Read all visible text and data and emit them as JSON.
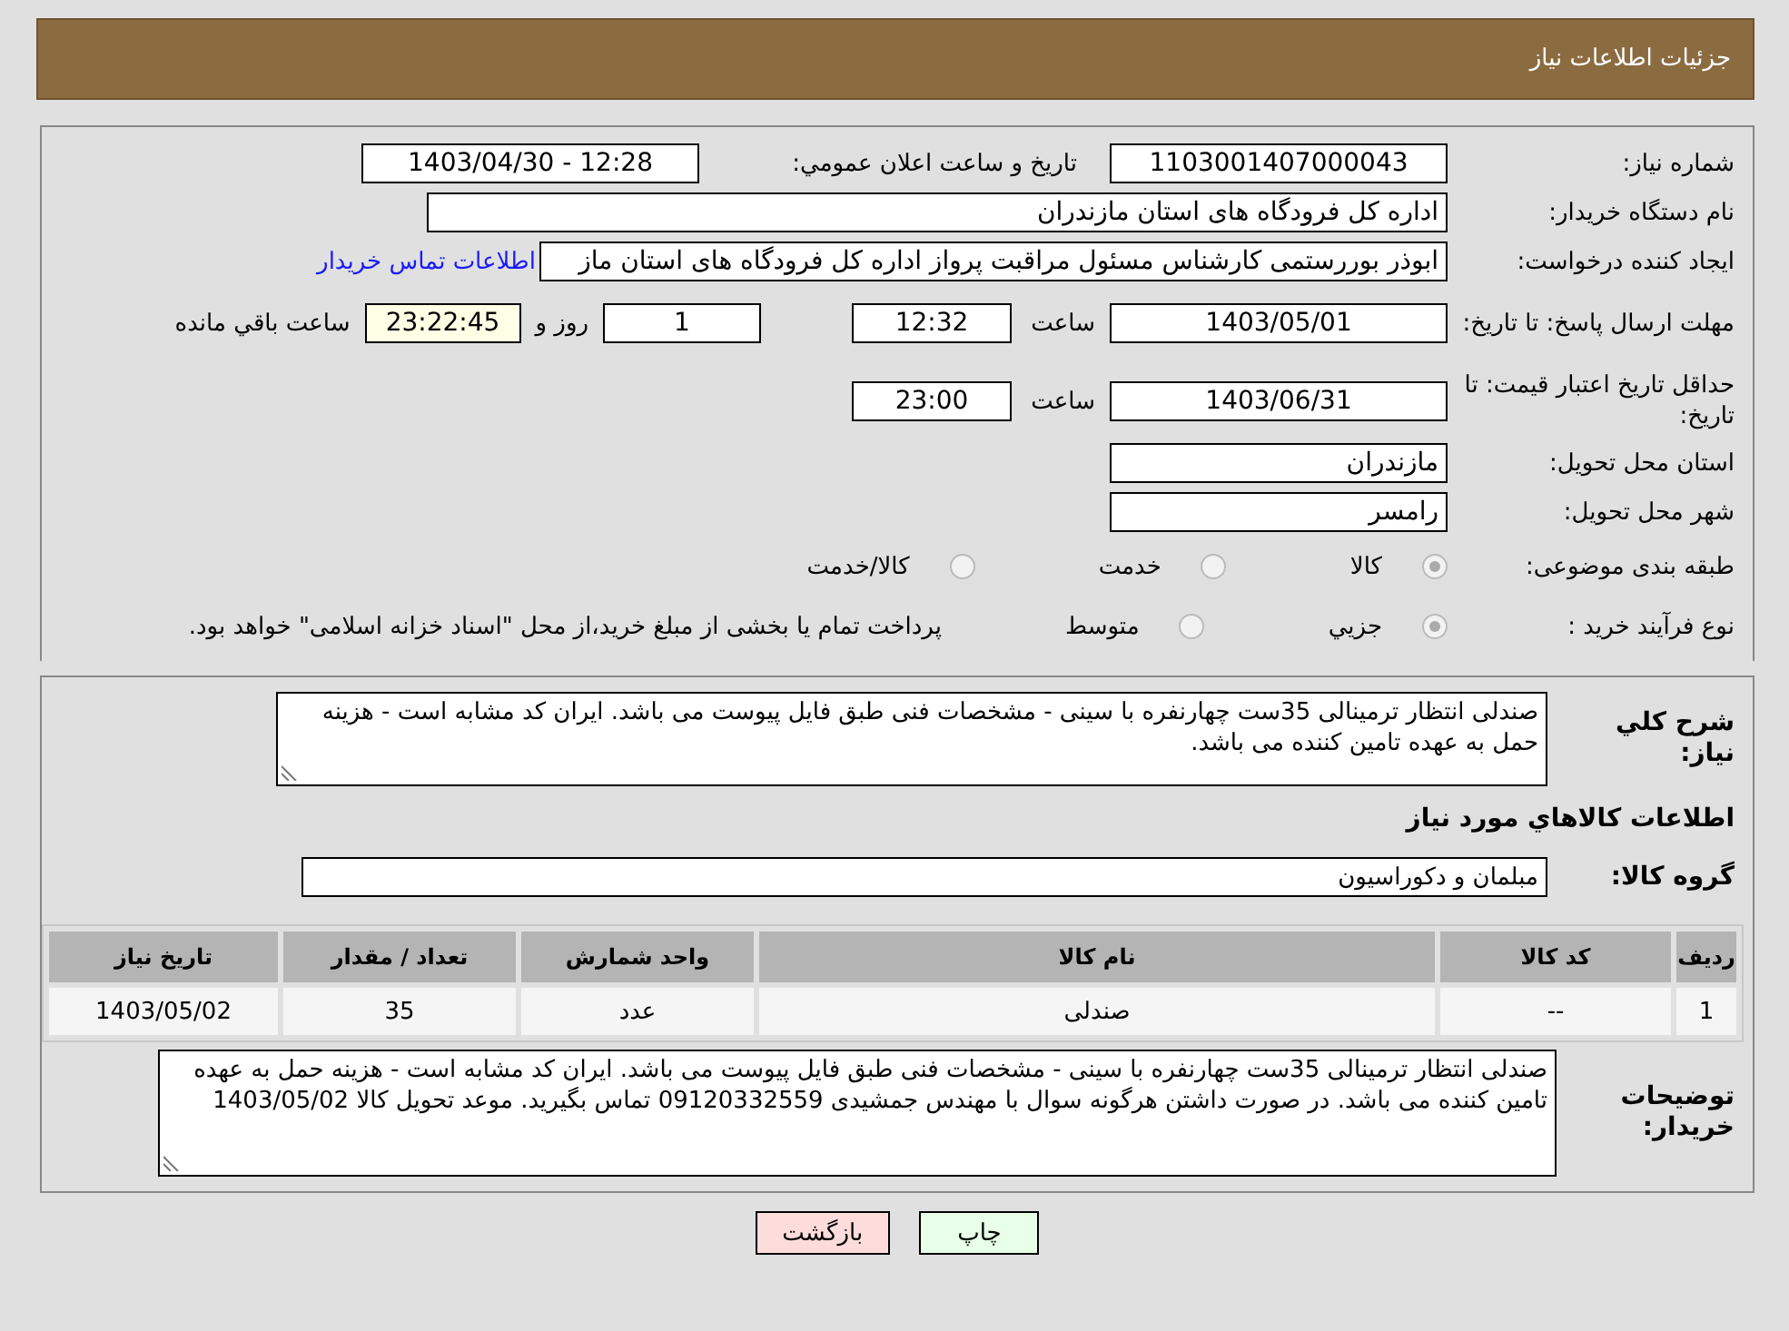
{
  "header": {
    "title": "جزئیات اطلاعات نیاز"
  },
  "need_number": {
    "label": "شماره نیاز:",
    "value": "1103001407000043"
  },
  "announce": {
    "label": "تاريخ و ساعت اعلان عمومي:",
    "value": "1403/04/30 - 12:28"
  },
  "buyer": {
    "label": "نام دستگاه خريدار:",
    "value": "اداره کل فرودگاه های استان مازندران"
  },
  "requester": {
    "label": "ايجاد کننده درخواست:",
    "value": "ابوذر بوررستمی کارشناس مسئول مراقبت پرواز اداره کل فرودگاه های استان ماز",
    "link": "اطلاعات تماس خريدار"
  },
  "deadline": {
    "label": "مهلت ارسال پاسخ: تا تاریخ:",
    "date": "1403/05/01",
    "time_label": "ساعت",
    "time": "12:32",
    "days": "1",
    "days_label": "روز و",
    "remaining": "23:22:45",
    "remaining_label": "ساعت باقي مانده"
  },
  "validity": {
    "label": "حداقل تاريخ اعتبار قيمت: تا تاریخ:",
    "date": "1403/06/31",
    "time_label": "ساعت",
    "time": "23:00"
  },
  "province": {
    "label": "استان محل تحويل:",
    "value": "مازندران"
  },
  "city": {
    "label": "شهر محل تحويل:",
    "value": "رامسر"
  },
  "category": {
    "label": "طبقه بندی موضوعی:",
    "options": [
      {
        "label": "کالا",
        "selected": true
      },
      {
        "label": "خدمت",
        "selected": false
      },
      {
        "label": "کالا/خدمت",
        "selected": false
      }
    ]
  },
  "purchase_type": {
    "label": "نوع فرآيند خريد :",
    "options": [
      {
        "label": "جزيي",
        "selected": true
      },
      {
        "label": "متوسط",
        "selected": false
      }
    ],
    "note": "پرداخت تمام يا بخشی از مبلغ خريد،از محل \"اسناد خزانه اسلامی\" خواهد بود."
  },
  "description": {
    "label": "شرح کلي نياز:",
    "value": "صندلی انتظار ترمینالی 35ست چهارنفره با سینی - مشخصات فنی طبق فایل پیوست می باشد. ایران کد مشابه است - هزینه حمل به عهده تامین کننده می باشد."
  },
  "goods_heading": "اطلاعات کالاهاي مورد نياز",
  "goods_group": {
    "label": "گروه کالا:",
    "value": "مبلمان و دکوراسیون"
  },
  "table": {
    "columns": [
      "رديف",
      "کد کالا",
      "نام کالا",
      "واحد شمارش",
      "تعداد / مقدار",
      "تاريخ نياز"
    ],
    "rows": [
      [
        "1",
        "--",
        "صندلی",
        "عدد",
        "35",
        "1403/05/02"
      ]
    ]
  },
  "buyer_notes": {
    "label": "توضيحات خريدار:",
    "value": "صندلی انتظار ترمینالی 35ست چهارنفره با سینی - مشخصات فنی طبق فایل پیوست می باشد. ایران کد مشابه است - هزینه حمل به عهده تامین کننده می باشد. در صورت داشتن هرگونه سوال با مهندس جمشیدی 09120332559 تماس بگیرید. موعد تحویل کالا 1403/05/02"
  },
  "buttons": [
    {
      "label": "چاپ",
      "kind": "print"
    },
    {
      "label": "بازگشت",
      "kind": "back"
    }
  ]
}
